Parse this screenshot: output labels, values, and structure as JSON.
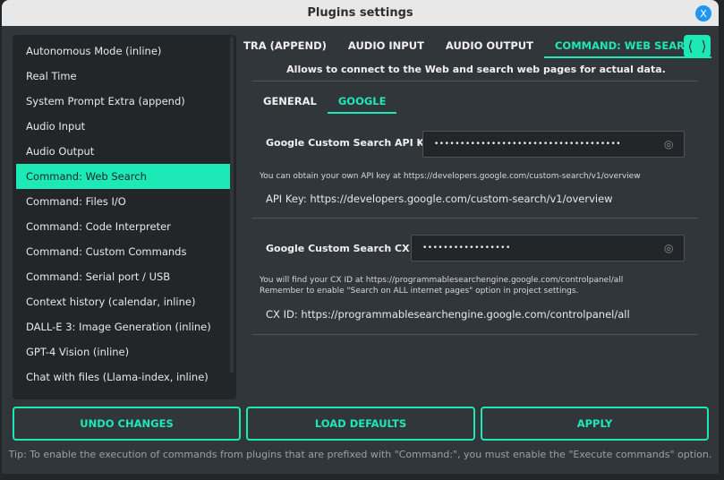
{
  "window": {
    "title": "Plugins settings",
    "close_label": "X"
  },
  "sidebar": {
    "items": [
      "Autonomous Mode (inline)",
      "Real Time",
      "System Prompt Extra (append)",
      "Audio Input",
      "Audio Output",
      "Command: Web Search",
      "Command: Files I/O",
      "Command: Code Interpreter",
      "Command: Custom Commands",
      "Command: Serial port / USB",
      "Context history (calendar, inline)",
      "DALL-E 3: Image Generation (inline)",
      "GPT-4 Vision (inline)",
      "Chat with files (Llama-index, inline)"
    ],
    "selected_index": 5
  },
  "tabs": {
    "items": [
      "TRA (APPEND)",
      "AUDIO INPUT",
      "AUDIO OUTPUT",
      "COMMAND: WEB SEARCH"
    ],
    "active_index": 3,
    "scroll_left": "⟨",
    "scroll_right": "⟩"
  },
  "description": "Allows to connect to the Web and search web pages for actual data.",
  "subtabs": {
    "items": [
      "GENERAL",
      "GOOGLE"
    ],
    "active_index": 1
  },
  "fields": {
    "api_key": {
      "label": "Google Custom Search API KEY",
      "value": "••••••••••••••••••••••••••••••••••••",
      "hint": "You can obtain your own API key at https://developers.google.com/custom-search/v1/overview",
      "link": "API Key: https://developers.google.com/custom-search/v1/overview"
    },
    "cx_id": {
      "label": "Google Custom Search CX ID",
      "value": "•••••••••••••••••",
      "hint1": "You will find your CX ID at https://programmablesearchengine.google.com/controlpanel/all",
      "hint2": "Remember to enable \"Search on ALL internet pages\" option in project settings.",
      "link": "CX ID: https://programmablesearchengine.google.com/controlpanel/all"
    }
  },
  "buttons": {
    "undo": "UNDO CHANGES",
    "defaults": "LOAD DEFAULTS",
    "apply": "APPLY"
  },
  "tip": "Tip: To enable the execution of commands from plugins that are prefixed with \"Command:\", you must enable the \"Execute commands\" option.",
  "colors": {
    "accent": "#1de9b6",
    "bg": "#31363b"
  }
}
